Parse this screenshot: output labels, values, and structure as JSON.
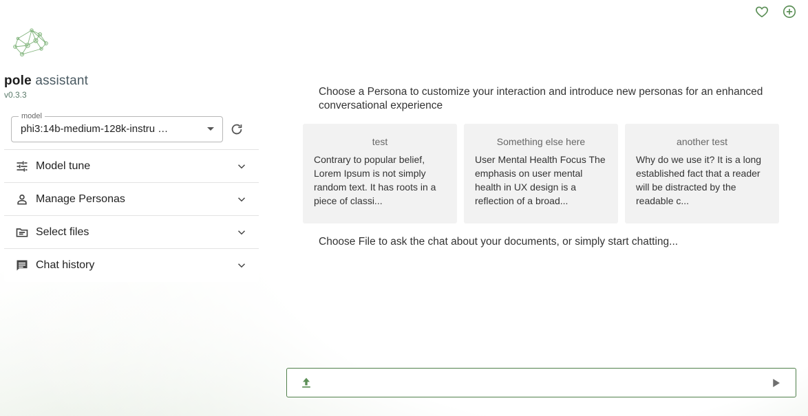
{
  "brand": {
    "name_bold": "pole",
    "name_light": " assistant",
    "version": "v0.3.3",
    "logo_icon": "network-graph-logo"
  },
  "top_icons": [
    "heart-icon",
    "add-circle-icon"
  ],
  "model": {
    "label": "model",
    "value": "phi3:14b-medium-128k-instru …"
  },
  "accordion": [
    {
      "label": "Model tune",
      "icon": "tune-sliders-icon"
    },
    {
      "label": "Manage Personas",
      "icon": "person-icon"
    },
    {
      "label": "Select files",
      "icon": "folder-icon"
    },
    {
      "label": "Chat history",
      "icon": "chat-icon"
    }
  ],
  "main": {
    "intro": "Choose a Persona to customize your interaction and introduce new personas for an enhanced conversational experience",
    "personas": [
      {
        "title": "test",
        "text": "Contrary to popular belief, Lorem Ipsum is not simply random text. It has roots in a piece of classi..."
      },
      {
        "title": "Something else here",
        "text": "User Mental Health Focus The emphasis on user mental health in UX design is a reflection of a broad..."
      },
      {
        "title": "another test",
        "text": "Why do we use it? It is a long established fact that a reader will be distracted by the readable c..."
      }
    ],
    "choose_file": "Choose File to ask the chat about your documents, or simply start chatting..."
  },
  "chat_input": {
    "value": "",
    "placeholder": ""
  },
  "colors": {
    "accent": "#4f7f4a",
    "icon_green": "#5b8f56"
  }
}
